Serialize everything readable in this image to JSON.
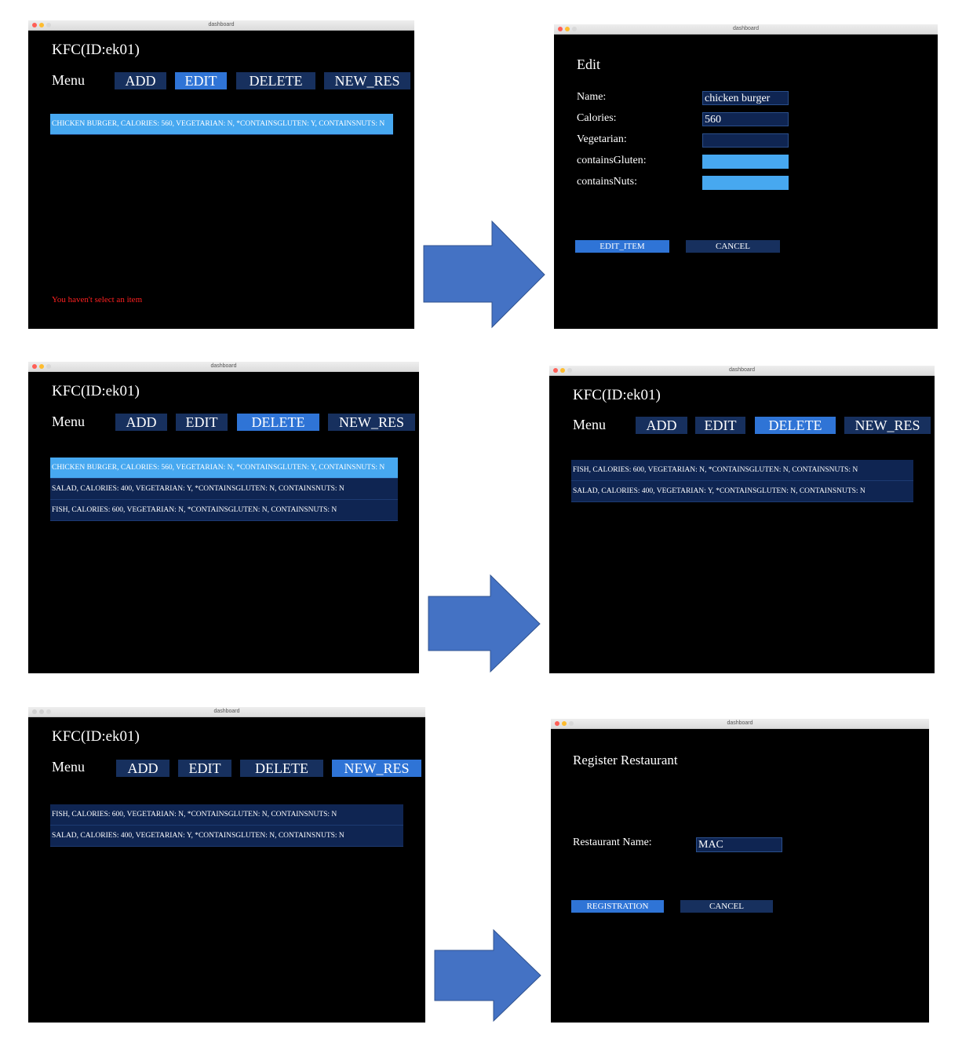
{
  "window_title": "dashboard",
  "dashboard": {
    "title": "KFC(ID:ek01)",
    "menu_label": "Menu",
    "buttons": {
      "add": "ADD",
      "edit": "EDIT",
      "delete": "DELETE",
      "new_res": "NEW_RES"
    }
  },
  "panel1": {
    "rows": [
      "CHICKEN BURGER, CALORIES: 560, VEGETARIAN: N, *CONTAINSGLUTEN: Y, CONTAINSNUTS: N"
    ],
    "error": "You haven't select an item"
  },
  "panel2": {
    "heading": "Edit",
    "labels": {
      "name": "Name:",
      "calories": "Calories:",
      "vegetarian": "Vegetarian:",
      "gluten": "containsGluten:",
      "nuts": "containsNuts:"
    },
    "values": {
      "name": "chicken burger",
      "calories": "560"
    },
    "buttons": {
      "edit_item": "EDIT_ITEM",
      "cancel": "CANCEL"
    }
  },
  "panel3": {
    "rows": [
      "CHICKEN BURGER, CALORIES: 560, VEGETARIAN: N, *CONTAINSGLUTEN: Y, CONTAINSNUTS: N",
      "SALAD, CALORIES: 400, VEGETARIAN: Y, *CONTAINSGLUTEN: N, CONTAINSNUTS: N",
      "FISH, CALORIES: 600, VEGETARIAN: N, *CONTAINSGLUTEN: N, CONTAINSNUTS: N"
    ]
  },
  "panel4": {
    "rows": [
      "FISH, CALORIES: 600, VEGETARIAN: N, *CONTAINSGLUTEN: N, CONTAINSNUTS: N",
      "SALAD, CALORIES: 400, VEGETARIAN: Y, *CONTAINSGLUTEN: N, CONTAINSNUTS: N"
    ]
  },
  "panel5": {
    "rows": [
      "FISH, CALORIES: 600, VEGETARIAN: N, *CONTAINSGLUTEN: N, CONTAINSNUTS: N",
      "SALAD, CALORIES: 400, VEGETARIAN: Y, *CONTAINSGLUTEN: N, CONTAINSNUTS: N"
    ]
  },
  "panel6": {
    "heading": "Register Restaurant",
    "label": "Restaurant Name:",
    "value": "MAC",
    "buttons": {
      "registration": "REGISTRATION",
      "cancel": "CANCEL"
    }
  },
  "colors": {
    "arrow": "#4472c4",
    "button": "#17305e",
    "button_active": "#2f74d6",
    "row": "#0f2552",
    "row_selected": "#47a8f0",
    "error": "#ff2020"
  }
}
